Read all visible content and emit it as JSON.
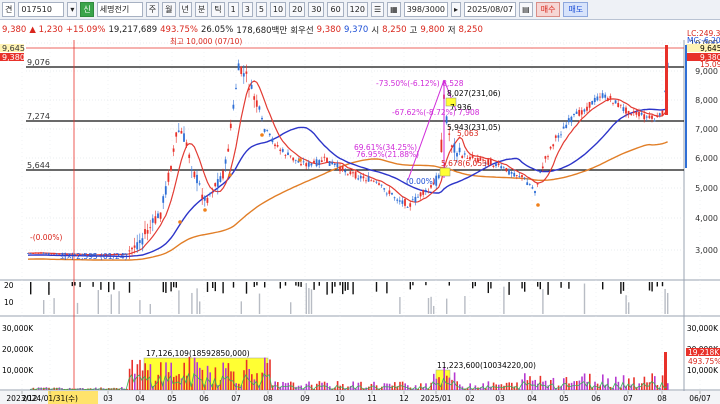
{
  "toolbar": {
    "code_prefix": "견",
    "code": "017510",
    "name_tag": "신",
    "name": "세명전기",
    "periods": [
      "주",
      "월",
      "년",
      "분",
      "틱",
      "1",
      "3",
      "5",
      "10",
      "20",
      "30",
      "60",
      "120"
    ],
    "page": "398/3000",
    "date": "2025/08/07",
    "buy_label": "매수",
    "sell_label": "매도"
  },
  "quote": {
    "price": "9,380",
    "change": "▲ 1,230",
    "change_pct": "+15.09%",
    "volume": "19,217,689",
    "turnover_pct": "493.75%",
    "ratio": "26.05%",
    "amount": "178,680백만",
    "credit_label": "회우선",
    "bid": "9,380",
    "ask": "9,370",
    "open_label": "시",
    "open": "8,250",
    "high_label": "고",
    "high": "9,800",
    "low_label": "저",
    "low": "8,250"
  },
  "price_axis": {
    "ticks": [
      "10,000",
      "9,000",
      "8,000",
      "7,000",
      "6,000",
      "5,000",
      "4,000",
      "3,000"
    ],
    "left_labels": [
      "9,645",
      "9,380",
      "9,076",
      "7,274",
      "5,644"
    ]
  },
  "right_labels": {
    "lc": "LC:249.35",
    "mc": "MC:-6.20",
    "price1": "9,645",
    "price2": "9,380",
    "pct": "15.09%"
  },
  "annotations": {
    "high_marker": "최고 10,000 (07/10)",
    "low_marker": "최저 2,595 (01/24)",
    "pct_low": "-(0.00%)",
    "fib1": "-73.50%(-6.12%) 8,528",
    "fib2": "-67.62%(-8.72%) 7,908",
    "fib3": "69.61%(34.25%)",
    "fib4": "76.95%(21.88%)",
    "fib5": "5,678(6,053)",
    "mark1": "8,027(231,06)",
    "mark2": "5,943(231,05)",
    "mark3": "(0.00%)",
    "mark4": "5,063",
    "mark5": "7,936"
  },
  "volume_axis": {
    "ticks": [
      "30,000K",
      "20,000K",
      "10,000K"
    ],
    "right_ticks": [
      "30,000K",
      "20,000K",
      "10,000K"
    ],
    "right_labels": [
      "19,218K",
      "493.75%"
    ]
  },
  "volume_boxes": {
    "box1": "17,126,109(18592850,000)",
    "box2": "11,223,600(10034220,00)"
  },
  "indicator_axis": {
    "ticks": [
      "20",
      "10"
    ]
  },
  "x_axis": {
    "labels": [
      "2023/12",
      "2024/01/31(수)",
      "03",
      "04",
      "05",
      "06",
      "07",
      "08",
      "09",
      "10",
      "11",
      "12",
      "2025/01",
      "02",
      "03",
      "04",
      "05",
      "06",
      "07",
      "08",
      "06/07"
    ]
  },
  "colors": {
    "up": "#e8312a",
    "down": "#2f6fd6",
    "ma_short": "#e23b33",
    "ma_mid": "#2d35c9",
    "ma_long": "#e17e27",
    "fib": "#d02ad9",
    "hline": "#111111",
    "highlight": "#ffff33"
  }
}
